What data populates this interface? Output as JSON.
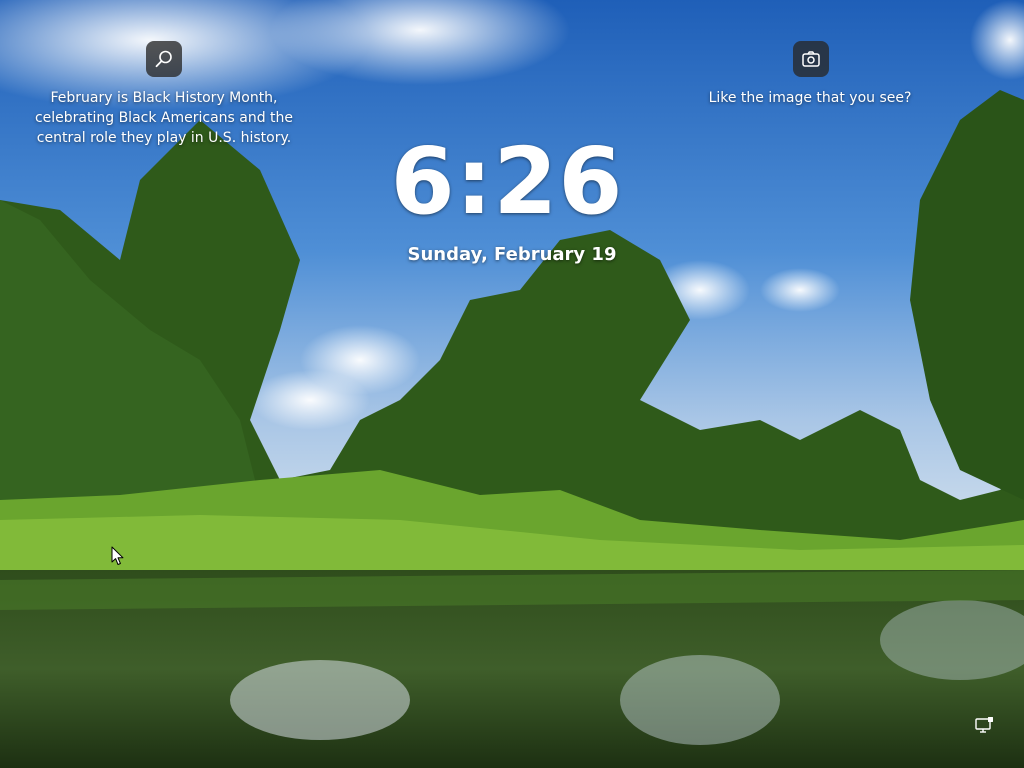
{
  "spotlight": {
    "left_caption": "February is Black History Month,\ncelebrating Black Americans and the\ncentral role they play in U.S. history.",
    "right_caption": "Like the image that you see?",
    "left_icon": "search-icon",
    "right_icon": "camera-icon"
  },
  "clock": {
    "time": "6:26",
    "date": "Sunday, February 19"
  },
  "status": {
    "network_icon": "network-icon"
  },
  "colors": {
    "sky": "#2d6fbf",
    "foliage": "#3d7a20",
    "water": "#27401a",
    "text": "#ffffff",
    "icon_bg": "#282828"
  }
}
